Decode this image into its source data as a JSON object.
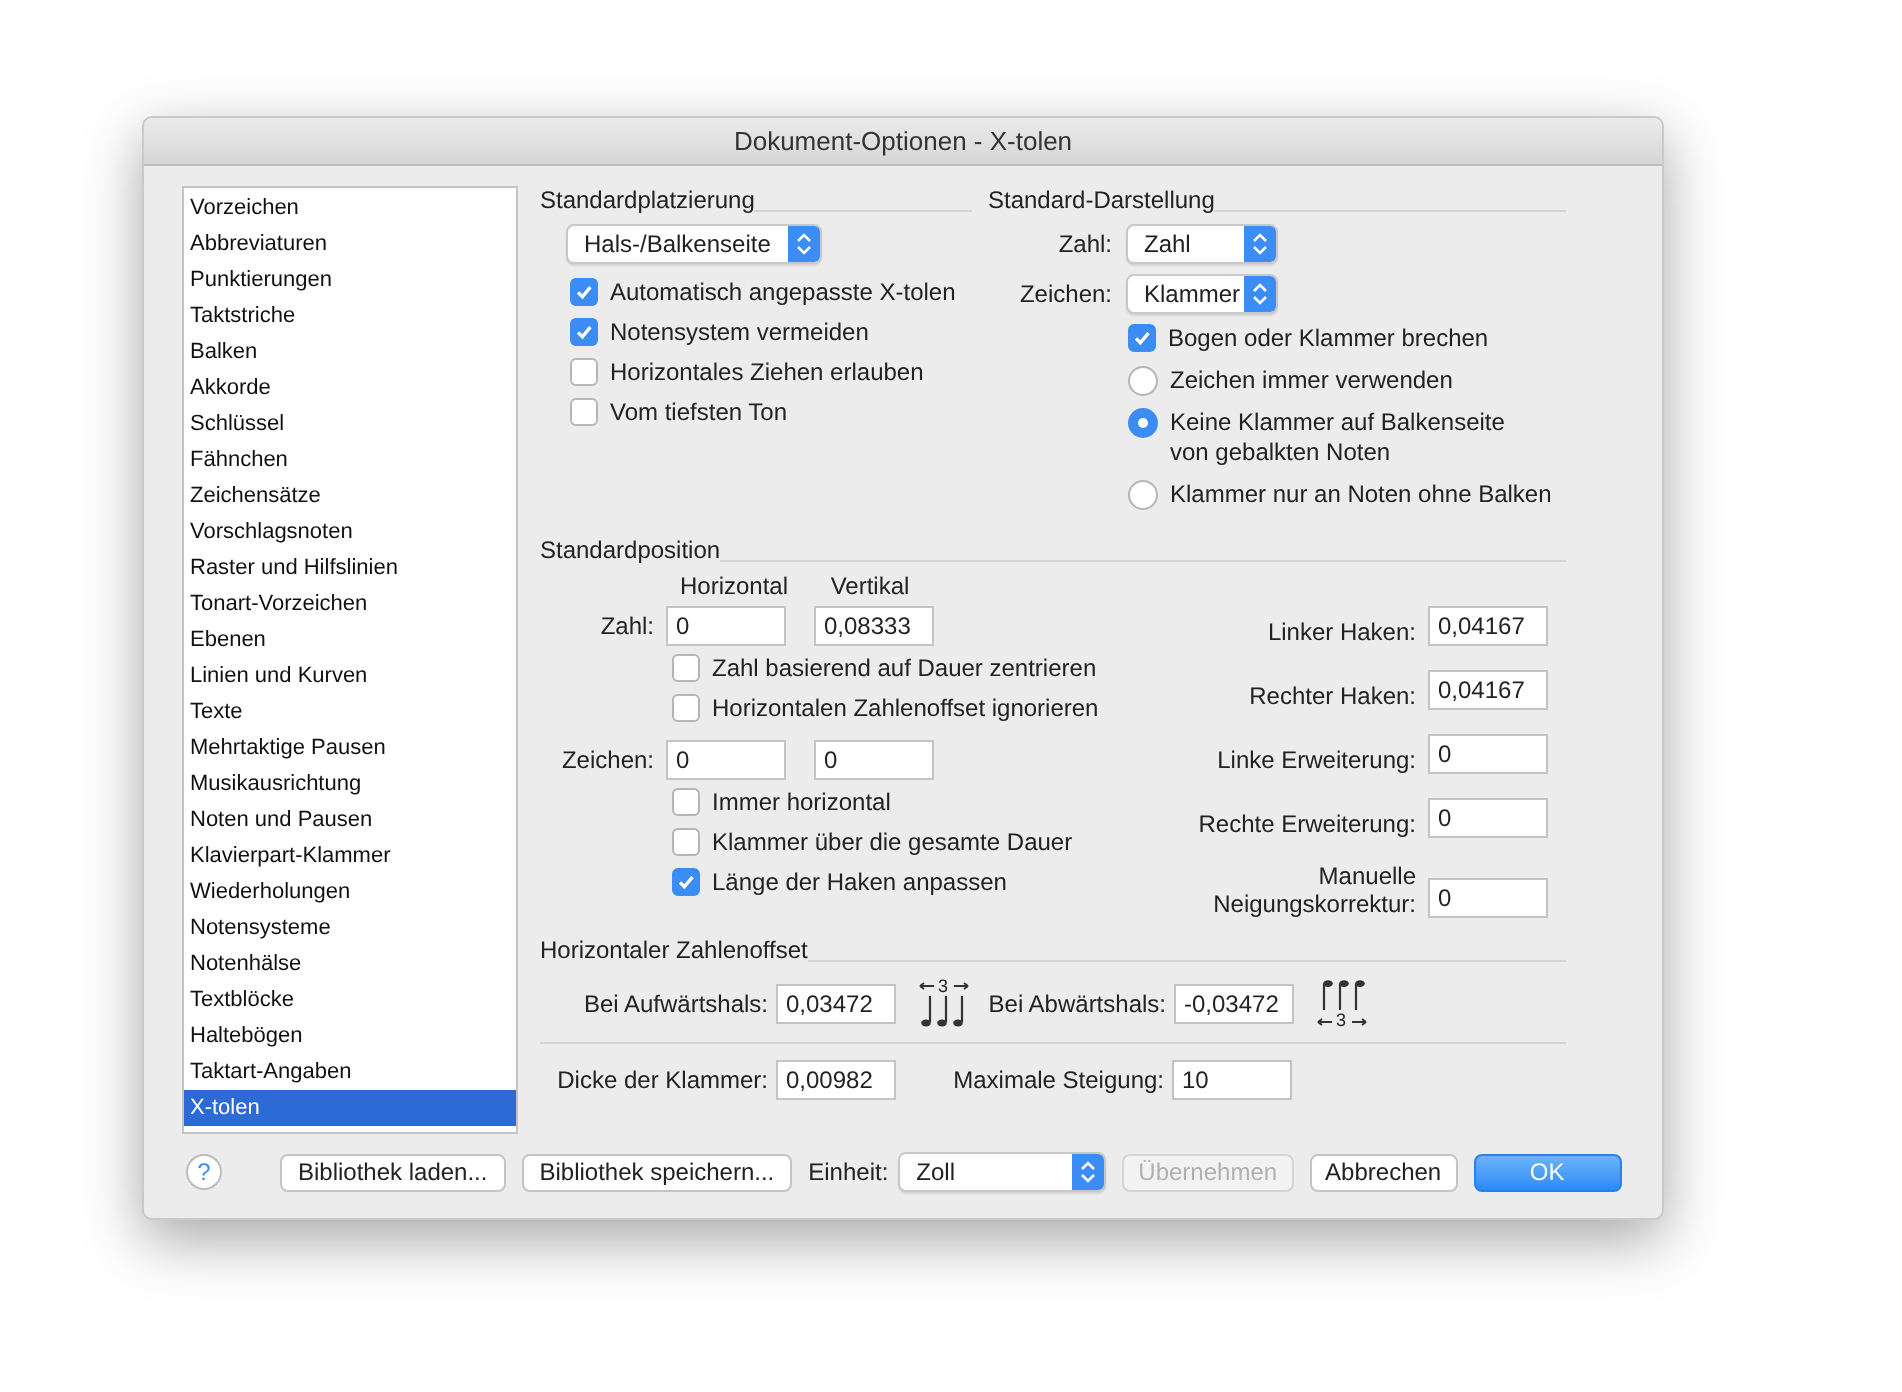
{
  "window": {
    "title": "Dokument-Optionen - X-tolen"
  },
  "sidebar": {
    "items": [
      {
        "label": "Vorzeichen",
        "selected": false
      },
      {
        "label": "Abbreviaturen",
        "selected": false
      },
      {
        "label": "Punktierungen",
        "selected": false
      },
      {
        "label": "Taktstriche",
        "selected": false
      },
      {
        "label": "Balken",
        "selected": false
      },
      {
        "label": "Akkorde",
        "selected": false
      },
      {
        "label": "Schlüssel",
        "selected": false
      },
      {
        "label": "Fähnchen",
        "selected": false
      },
      {
        "label": "Zeichensätze",
        "selected": false
      },
      {
        "label": "Vorschlagsnoten",
        "selected": false
      },
      {
        "label": "Raster und Hilfslinien",
        "selected": false
      },
      {
        "label": "Tonart-Vorzeichen",
        "selected": false
      },
      {
        "label": "Ebenen",
        "selected": false
      },
      {
        "label": "Linien und Kurven",
        "selected": false
      },
      {
        "label": "Texte",
        "selected": false
      },
      {
        "label": "Mehrtaktige Pausen",
        "selected": false
      },
      {
        "label": "Musikausrichtung",
        "selected": false
      },
      {
        "label": "Noten und Pausen",
        "selected": false
      },
      {
        "label": "Klavierpart-Klammer",
        "selected": false
      },
      {
        "label": "Wiederholungen",
        "selected": false
      },
      {
        "label": "Notensysteme",
        "selected": false
      },
      {
        "label": "Notenhälse",
        "selected": false
      },
      {
        "label": "Textblöcke",
        "selected": false
      },
      {
        "label": "Haltebögen",
        "selected": false
      },
      {
        "label": "Taktart-Angaben",
        "selected": false
      },
      {
        "label": "X-tolen",
        "selected": true
      }
    ]
  },
  "placement": {
    "title": "Standardplatzierung",
    "popup": {
      "value": "Hals-/Balkenseite"
    },
    "checkboxes": [
      {
        "label": "Automatisch angepasste X-tolen",
        "checked": true
      },
      {
        "label": "Notensystem vermeiden",
        "checked": true
      },
      {
        "label": "Horizontales Ziehen erlauben",
        "checked": false
      },
      {
        "label": "Vom tiefsten Ton",
        "checked": false
      }
    ]
  },
  "display": {
    "title": "Standard-Darstellung",
    "fields": [
      {
        "label": "Zahl:",
        "value": "Zahl"
      },
      {
        "label": "Zeichen:",
        "value": "Klammer"
      }
    ],
    "options": [
      {
        "kind": "checkbox",
        "label": "Bogen oder Klammer brechen",
        "checked": true
      },
      {
        "kind": "radio",
        "label": "Zeichen immer verwenden",
        "selected": false
      },
      {
        "kind": "radio",
        "label": "Keine Klammer auf Balkenseite\nvon gebalkten Noten",
        "selected": true
      },
      {
        "kind": "radio",
        "label": "Klammer nur an Noten ohne Balken",
        "selected": false
      }
    ]
  },
  "position": {
    "title": "Standardposition",
    "column_headers": [
      "Horizontal",
      "Vertikal"
    ],
    "rows": [
      {
        "label": "Zahl:",
        "horizontal": "0",
        "vertical": "0,08333",
        "checkboxes": [
          {
            "label": "Zahl basierend auf Dauer zentrieren",
            "checked": false
          },
          {
            "label": "Horizontalen Zahlenoffset ignorieren",
            "checked": false
          }
        ]
      },
      {
        "label": "Zeichen:",
        "horizontal": "0",
        "vertical": "0",
        "checkboxes": [
          {
            "label": "Immer horizontal",
            "checked": false
          },
          {
            "label": "Klammer über die gesamte Dauer",
            "checked": false
          },
          {
            "label": "Länge der Haken anpassen",
            "checked": true
          }
        ]
      }
    ],
    "hooks": [
      {
        "label": "Linker Haken:",
        "value": "0,04167"
      },
      {
        "label": "Rechter Haken:",
        "value": "0,04167"
      },
      {
        "label": "Linke Erweiterung:",
        "value": "0"
      },
      {
        "label": "Rechte Erweiterung:",
        "value": "0"
      },
      {
        "label": "Manuelle\nNeigungskorrektur:",
        "value": "0"
      }
    ]
  },
  "offset": {
    "title": "Horizontaler Zahlenoffset",
    "fields": [
      {
        "label": "Bei Aufwärtshals:",
        "value": "0,03472",
        "kind": "stem-up",
        "tuplet_number": "3"
      },
      {
        "label": "Bei Abwärtshals:",
        "value": "-0,03472",
        "kind": "stem-down",
        "tuplet_number": "3"
      }
    ]
  },
  "bracket": {
    "fields": [
      {
        "label": "Dicke der Klammer:",
        "value": "0,00982"
      },
      {
        "label": "Maximale Steigung:",
        "value": "10"
      }
    ]
  },
  "footer": {
    "help": "?",
    "library_buttons": [
      {
        "label": "Bibliothek laden..."
      },
      {
        "label": "Bibliothek speichern..."
      }
    ],
    "unit": {
      "label": "Einheit:",
      "value": "Zoll"
    },
    "actions": [
      {
        "label": "Übernehmen",
        "disabled": true,
        "default": false
      },
      {
        "label": "Abbrechen",
        "disabled": false,
        "default": false
      },
      {
        "label": "OK",
        "disabled": false,
        "default": true
      }
    ]
  }
}
